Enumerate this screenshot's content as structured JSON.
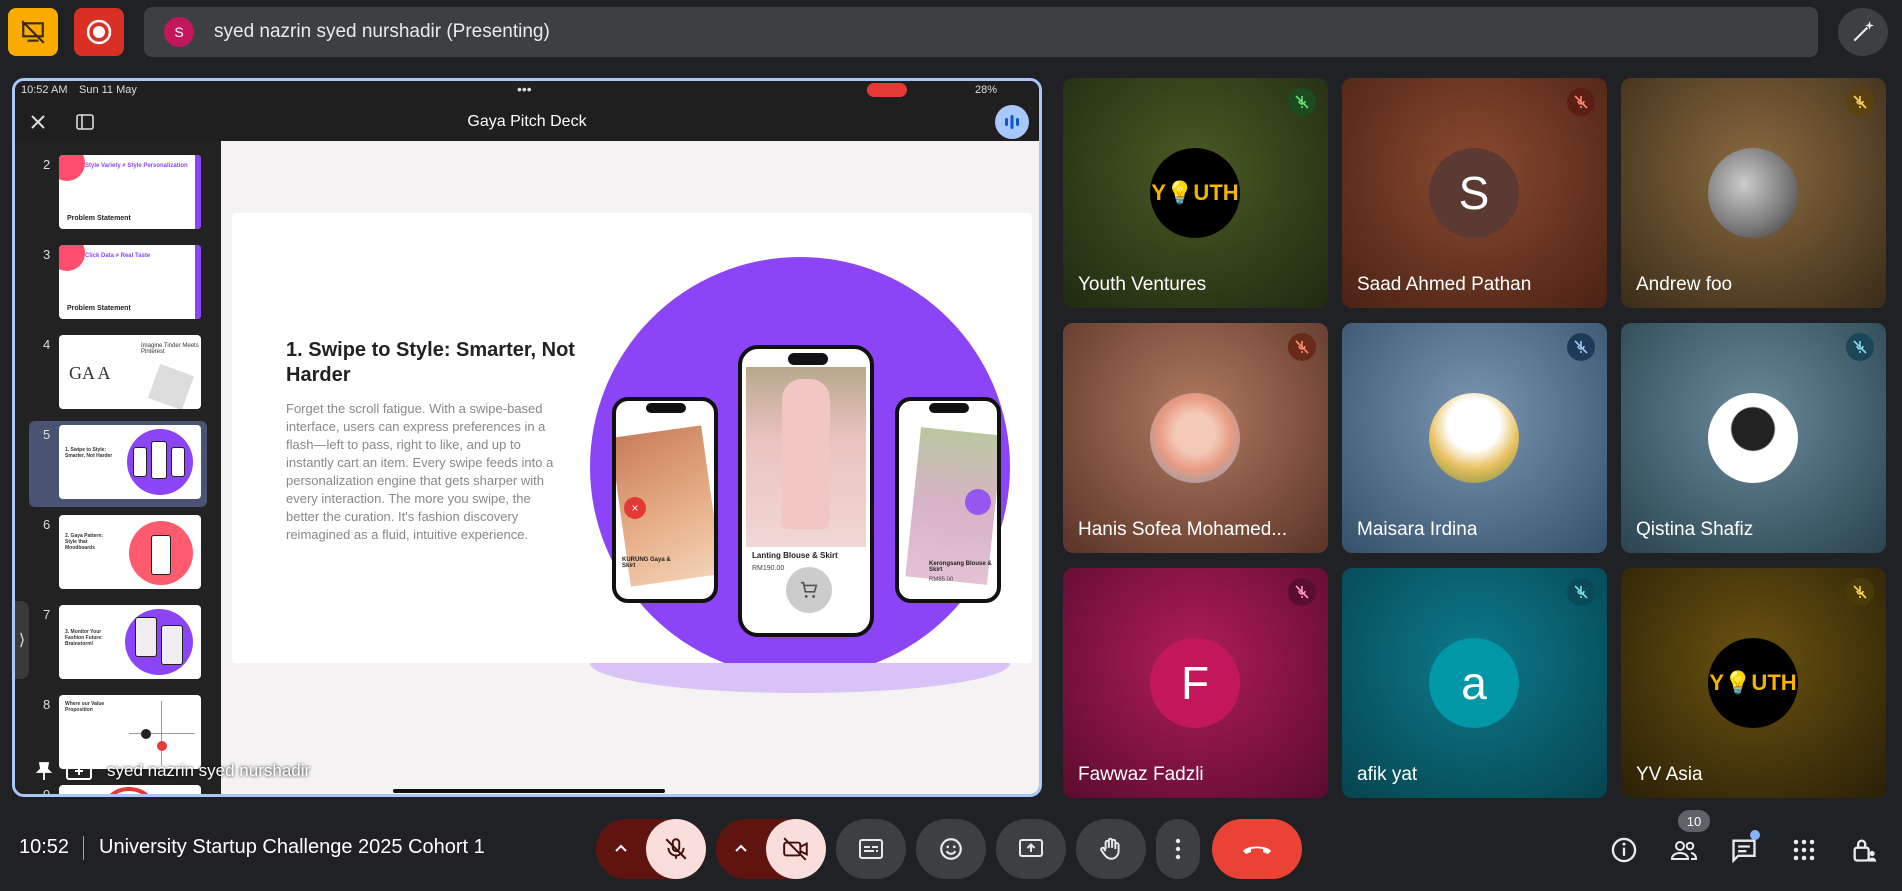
{
  "top_bar": {
    "presenter_initial": "S",
    "presenting_text": "syed nazrin syed nurshadir (Presenting)"
  },
  "shared_screen": {
    "status_time": "10:52 AM",
    "status_date": "Sun 11 May",
    "battery": "28%",
    "app_title": "Gaya Pitch Deck",
    "presenter_label": "syed nazrin syed nurshadir",
    "thumbnails": [
      {
        "num": "2",
        "caption": "Problem Statement",
        "heading": "Style Variety ≠ Style Personalization"
      },
      {
        "num": "3",
        "caption": "Problem Statement",
        "heading": "Click Data ≠ Real Taste"
      },
      {
        "num": "4",
        "caption": "",
        "heading": "Imagine Tinder Meets Pinterest"
      },
      {
        "num": "5",
        "caption": "",
        "heading": "1. Swipe to Style: Smarter, Not Harder"
      },
      {
        "num": "6",
        "caption": "",
        "heading": "2. Gaya Pattern: Style that Moodboards"
      },
      {
        "num": "7",
        "caption": "",
        "heading": "3. Monitor Your Fashion Future: Brainstorm!"
      },
      {
        "num": "8",
        "caption": "",
        "heading": "Where our Value Proposition"
      },
      {
        "num": "9",
        "caption": "",
        "heading": ""
      }
    ],
    "slide": {
      "title": "1. Swipe to Style: Smarter, Not Harder",
      "body": "Forget the scroll fatigue. With a swipe-based interface, users can express preferences in a flash—left to pass, right to like, and up to instantly cart an item. Every swipe feeds into a personalization engine that gets sharper with every interaction. The more you swipe, the better the curation. It's fashion discovery reimagined as a fluid, intuitive experience.",
      "phone_center_caption": "Lanting Blouse & Skirt",
      "phone_center_price": "RM190.00",
      "phone_left_caption": "KURUNG Gaya & Skirt",
      "phone_right_caption": "Kerongsang Blouse & Skirt",
      "phone_right_price": "RM85.00"
    }
  },
  "participants": [
    {
      "name": "Youth Ventures",
      "avatar": "Y💡UTH",
      "type": "logo",
      "bg": "#3a4a1c",
      "mic_color": "#2e7d32"
    },
    {
      "name": "Saad Ahmed Pathan",
      "avatar": "S",
      "type": "letter",
      "bg": "#6b3322",
      "mic_color": "#7a2a1a",
      "avatar_bg": "#5a3a32"
    },
    {
      "name": "Andrew foo",
      "avatar": "",
      "type": "photo",
      "bg": "#6b5030",
      "mic_color": "#7a5a1a"
    },
    {
      "name": "Hanis Sofea Mohamed...",
      "avatar": "",
      "type": "photo",
      "bg": "#7a5040",
      "mic_color": "#6a2a1a"
    },
    {
      "name": "Maisara Irdina",
      "avatar": "",
      "type": "photo",
      "bg": "#4a6a8a",
      "mic_color": "#2a4a6a"
    },
    {
      "name": "Qistina Shafiz",
      "avatar": "",
      "type": "photo",
      "bg": "#3a5a6a",
      "mic_color": "#2a5a6a"
    },
    {
      "name": "Fawwaz Fadzli",
      "avatar": "F",
      "type": "letter",
      "bg": "#8a1a4a",
      "mic_color": "#6a1034",
      "avatar_bg": "#c2185b"
    },
    {
      "name": "afik yat",
      "avatar": "a",
      "type": "letter",
      "bg": "#0e6a78",
      "mic_color": "#0a4a56",
      "avatar_bg": "#0097a7"
    },
    {
      "name": "YV Asia",
      "avatar": "Y💡UTH",
      "type": "logo",
      "bg": "#5a4810",
      "mic_color": "#5a4810"
    }
  ],
  "bottom_bar": {
    "time": "10:52",
    "meeting_name": "University Startup Challenge 2025 Cohort 1",
    "people_count": "10"
  },
  "colors": {
    "accent_purple": "#8b45f7",
    "end_call_red": "#ea4335",
    "mic_off_bg": "#f9dedc",
    "record_red": "#d93025",
    "badge_yellow": "#f9ab00"
  }
}
